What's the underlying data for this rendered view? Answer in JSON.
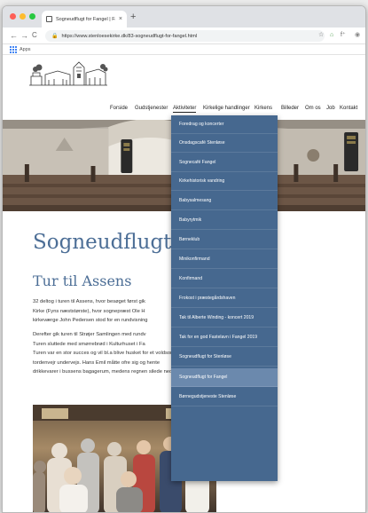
{
  "browser": {
    "tab_title": "Sogneudflugt for Fangel | Fang...",
    "tab_close": "×",
    "new_tab": "+",
    "url": "https://www.stenloesekirke.dk/83-sogneudflugt-for-fangel.html",
    "bookmarks_label": "Apps",
    "back_icon": "←",
    "forward_icon": "→",
    "reload_icon": "C",
    "lock_icon": "🔒",
    "star_icon": "☆",
    "ext_icon": "⌂",
    "font_icon": "f⁺",
    "menu_icon": "⋮",
    "profile_icon": "◉"
  },
  "nav": {
    "items": [
      "Forside",
      "Gudstjenester",
      "Aktiviteter",
      "Kirkelige handlinger",
      "Kirkens",
      "Billeder",
      "Om os",
      "Job",
      "Kontakt"
    ]
  },
  "dropdown": {
    "items": [
      "Foredrag og koncerter",
      "Onsdagscafé Stenløse",
      "Sognecafé Fangel",
      "Kirkehistorisk vandring",
      "Babysalmesang",
      "Babyrytmik",
      "Børneklub",
      "Minikonfirmand",
      "Konfirmand",
      "Frokost i præstegårdshaven",
      "Tak til Alberte Winding - koncert 2019",
      "Tak for en god Fastelavn i Fangel 2019",
      "Sogneudflugt for Stenløse",
      "Sogneudflugt for Fangel",
      "Børnegudstjeneste Stenløse"
    ],
    "highlighted_index": 13
  },
  "content": {
    "heading": "Sogneudflugt for",
    "subheading": "Tur til Assens",
    "para1": [
      "32 deltog i turen til Assens, hvor besøget først gik",
      "Kirke (Fyns næststørste), hvor sognepræst Ole H",
      "kirkeværge John Pedersen stod for en rundvisning"
    ],
    "para2": [
      "Derefter gik turen til Strøjer Samlingen med rundv",
      "Turen sluttede med smørrebrød i Kulturhuset i Fa",
      "Turen var en stor succes og vil bl.a blive husket for et voldsomt",
      "tordenvejr undervejs. Hans Emil måtte ofre sig og hente",
      "drikkevarer i bussens bagagerum, medens regnen silede ned."
    ]
  },
  "colors": {
    "accent": "#46688f",
    "highlight": "#6b89ad",
    "heading": "#4c6e96"
  }
}
